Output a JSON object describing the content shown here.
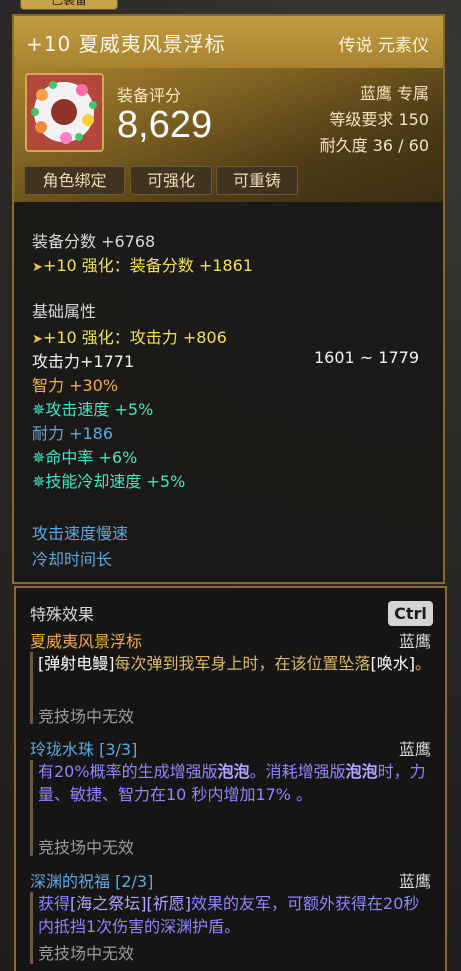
{
  "top_tab": "已装备",
  "item": {
    "name": "+10 夏威夷风景浮标",
    "grade": "传说 元素仪",
    "score_label": "装备评分",
    "score": "8,629",
    "class_tag": "蓝鹰 专属",
    "level_req": "等级要求 150",
    "durability": "耐久度 36 / 60",
    "tags": [
      "角色绑定",
      "可强化",
      "可重铸"
    ]
  },
  "stats": {
    "gear_score": "装备分数 +6768",
    "enhance_gear_score": "+10 强化：装备分数 +1861",
    "base_title": "基础属性",
    "enhance_attack": "+10 强化：攻击力 +806",
    "attack": "攻击力+1771",
    "attack_range": "1601 ~ 1779",
    "intelligence": "智力 +30%",
    "attack_speed": "攻击速度 +5%",
    "stamina": "耐力 +186",
    "accuracy": "命中率 +6%",
    "cooldown": "技能冷却速度 +5%",
    "note1": "攻击速度慢速",
    "note2": "冷却时间长"
  },
  "special": {
    "title": "特殊效果",
    "ctrl": "Ctrl",
    "effects": [
      {
        "name": "夏威夷风景浮标",
        "class": "蓝鹰",
        "desc_bracket": "[弹射电鳗]",
        "desc_middle": "每次弹到我军身上时，在该位置坠落",
        "desc_bracket2": "[唤水]",
        "desc_end": "。",
        "note": "竞技场中无效"
      },
      {
        "name": "玲珑水珠 [3/3]",
        "class": "蓝鹰",
        "desc_a": "有20%概率的生成增强版",
        "desc_bold1": "泡泡",
        "desc_b": "。消耗增强版",
        "desc_bold2": "泡泡",
        "desc_c": "时，力量、敏捷、智力在10 秒内增加17% 。",
        "note": "竞技场中无效"
      },
      {
        "name": "深渊的祝福 [2/3]",
        "class": "蓝鹰",
        "desc_a": "获得",
        "desc_h1": "[海之祭坛]",
        "desc_h2": "[祈愿]",
        "desc_b": "效果的友军，可额外获得在20秒内抵挡1次伤害的深渊护盾。",
        "note": "竞技场中无效"
      }
    ]
  }
}
